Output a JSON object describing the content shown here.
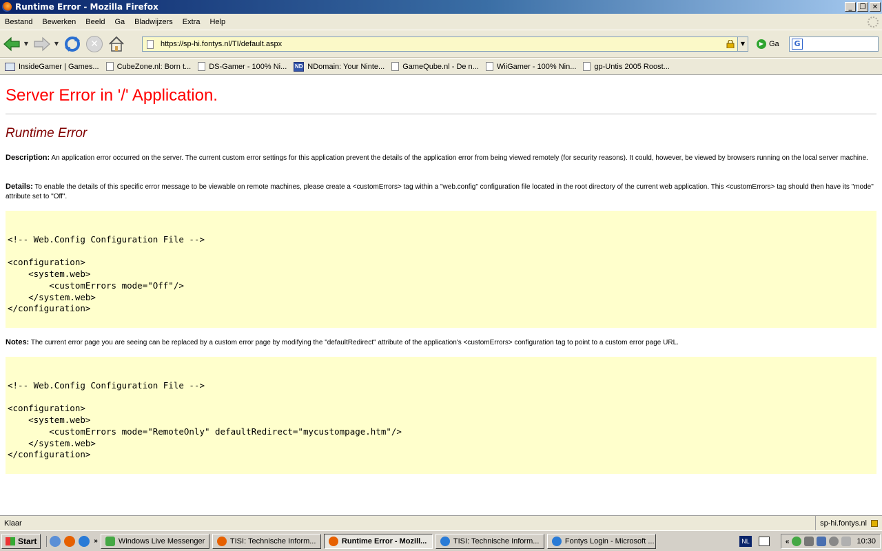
{
  "window": {
    "title": "Runtime Error - Mozilla Firefox"
  },
  "menu": {
    "items": [
      "Bestand",
      "Bewerken",
      "Beeld",
      "Ga",
      "Bladwijzers",
      "Extra",
      "Help"
    ]
  },
  "nav": {
    "url": "https://sp-hi.fontys.nl/TI/default.aspx",
    "go_label": "Ga",
    "buttons": [
      "back-icon",
      "forward-icon",
      "reload-icon",
      "stop-icon",
      "home-icon"
    ]
  },
  "bookmarks": [
    {
      "label": "InsideGamer | Games...",
      "icon": "insidegamer-icon"
    },
    {
      "label": "CubeZone.nl: Born t...",
      "icon": "page-icon"
    },
    {
      "label": "DS-Gamer - 100% Ni...",
      "icon": "page-icon"
    },
    {
      "label": "NDomain: Your Ninte...",
      "icon": "ndomain-icon"
    },
    {
      "label": "GameQube.nl - De n...",
      "icon": "page-icon"
    },
    {
      "label": "WiiGamer - 100% Nin...",
      "icon": "page-icon"
    },
    {
      "label": "gp-Untis 2005 Roost...",
      "icon": "page-icon"
    }
  ],
  "page": {
    "heading": "Server Error in '/' Application.",
    "subheading": "Runtime Error",
    "description_label": "Description:",
    "description_text": "An application error occurred on the server. The current custom error settings for this application prevent the details of the application error from being viewed remotely (for security reasons). It could, however, be viewed by browsers running on the local server machine.",
    "details_label": "Details:",
    "details_text": "To enable the details of this specific error message to be viewable on remote machines, please create a <customErrors> tag within a \"web.config\" configuration file located in the root directory of the current web application. This <customErrors> tag should then have its \"mode\" attribute set to \"Off\".",
    "code1": "\n\n<!-- Web.Config Configuration File -->\n\n<configuration>\n    <system.web>\n        <customErrors mode=\"Off\"/>\n    </system.web>\n</configuration>",
    "notes_label": "Notes:",
    "notes_text": "The current error page you are seeing can be replaced by a custom error page by modifying the \"defaultRedirect\" attribute of the application's <customErrors> configuration tag to point to a custom error page URL.",
    "code2": "\n\n<!-- Web.Config Configuration File -->\n\n<configuration>\n    <system.web>\n        <customErrors mode=\"RemoteOnly\" defaultRedirect=\"mycustompage.htm\"/>\n    </system.web>\n</configuration>"
  },
  "status": {
    "text": "Klaar",
    "host": "sp-hi.fontys.nl"
  },
  "taskbar": {
    "start_label": "Start",
    "tasks": [
      {
        "label": "Windows Live Messenger",
        "active": false
      },
      {
        "label": "TISI: Technische Inform...",
        "active": false
      },
      {
        "label": "Runtime Error - Mozill...",
        "active": true
      },
      {
        "label": "TISI: Technische Inform...",
        "active": false
      },
      {
        "label": "Fontys Login - Microsoft ...",
        "active": false
      }
    ],
    "language": "NL",
    "clock": "10:30"
  },
  "colors": {
    "heading": "#ff0000",
    "subheading": "#800000",
    "code_background": "#ffffcc",
    "url_background": "#fbf9c8"
  }
}
